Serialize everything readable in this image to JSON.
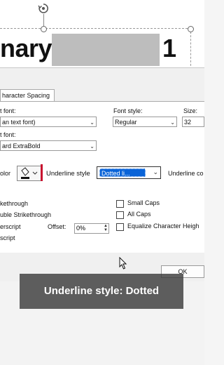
{
  "slide": {
    "title_fragment": "nary",
    "title_number": "1"
  },
  "dialog": {
    "tab_label": "haracter Spacing",
    "latin_font_label": "t font:",
    "latin_font_value": "an text font)",
    "font_style_label": "Font style:",
    "font_style_value": "Regular",
    "size_label": "Size:",
    "size_value": "32",
    "asian_font_label": "t font:",
    "asian_font_value": "ard ExtraBold",
    "color_label": "olor",
    "underline_style_label": "Underline style",
    "underline_style_value": "Dotted li...",
    "underline_color_label": "Underline co",
    "effects": {
      "strikethrough": "kethrough",
      "double_strikethrough": "uble Strikethrough",
      "superscript": "erscript",
      "subscript": "script",
      "offset_label": "Offset:",
      "offset_value": "0%",
      "small_caps": "Small Caps",
      "all_caps": "All Caps",
      "equalize": "Equalize Character Heigh"
    },
    "ok_label": "OK"
  },
  "caption": {
    "text": "Underline style: Dotted"
  },
  "colors": {
    "accent": "#0a64d8",
    "underline_color_bar": "#c8102e"
  }
}
